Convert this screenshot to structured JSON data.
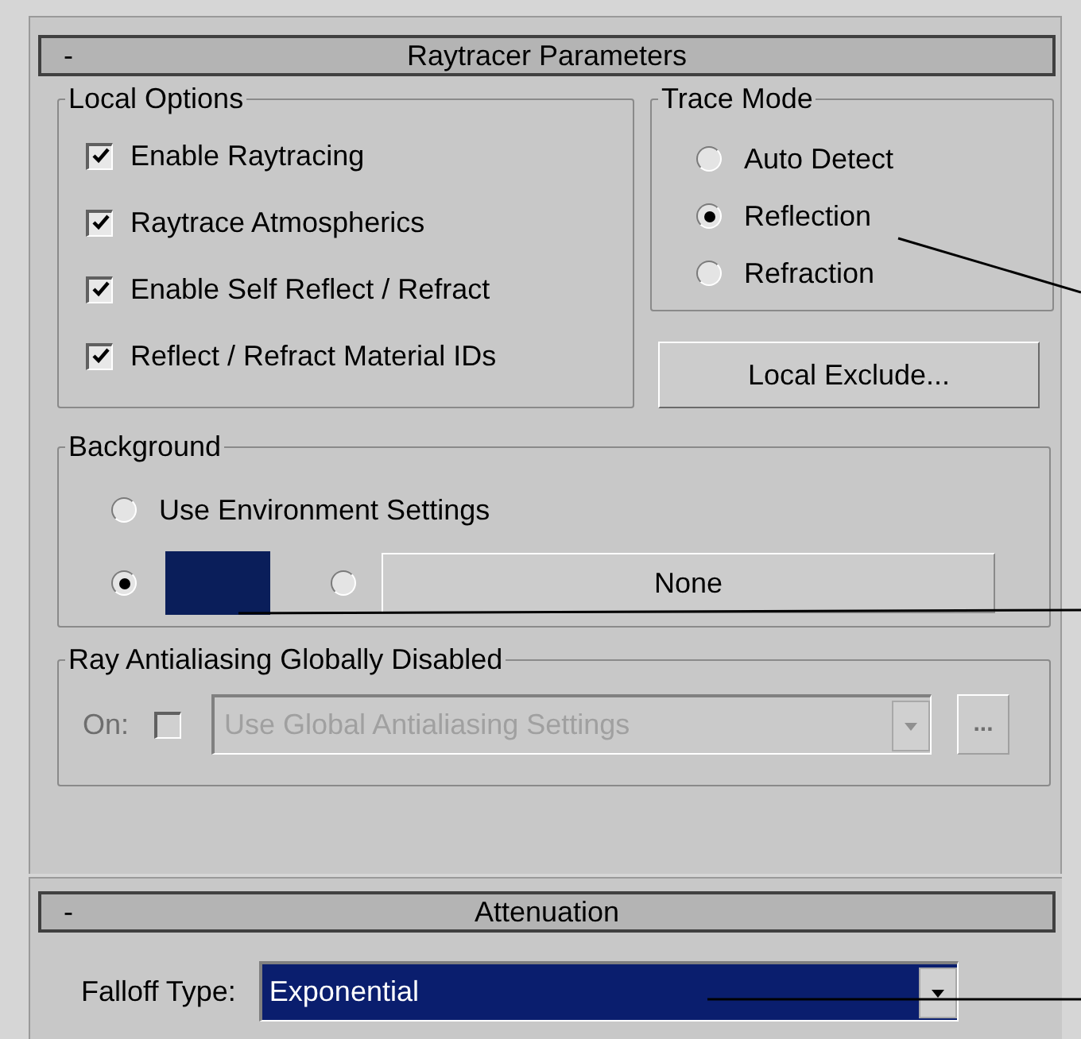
{
  "raytracer": {
    "sign": "-",
    "title": "Raytracer Parameters",
    "local_options": {
      "title": "Local Options",
      "checkboxes": [
        {
          "label": "Enable Raytracing",
          "checked": true
        },
        {
          "label": "Raytrace Atmospherics",
          "checked": true
        },
        {
          "label": "Enable Self Reflect / Refract",
          "checked": true
        },
        {
          "label": "Reflect / Refract Material IDs",
          "checked": true
        }
      ]
    },
    "trace_mode": {
      "title": "Trace Mode",
      "options": [
        {
          "label": "Auto Detect",
          "selected": false
        },
        {
          "label": "Reflection",
          "selected": true
        },
        {
          "label": "Refraction",
          "selected": false
        }
      ]
    },
    "local_exclude_button": "Local Exclude...",
    "background": {
      "title": "Background",
      "environment": {
        "label": "Use Environment Settings",
        "selected": false
      },
      "color": {
        "color": "#0a1e5a",
        "selected": true
      },
      "map": {
        "label": "None",
        "selected": false
      }
    },
    "antialiasing": {
      "title": "Ray Antialiasing Globally Disabled",
      "disabled": true,
      "on_label": "On:",
      "on_checked": false,
      "dropdown_value": "Use Global Antialiasing Settings",
      "more_button": "..."
    }
  },
  "attenuation": {
    "sign": "-",
    "title": "Attenuation",
    "falloff_label": "Falloff Type:",
    "falloff_value": "Exponential"
  }
}
